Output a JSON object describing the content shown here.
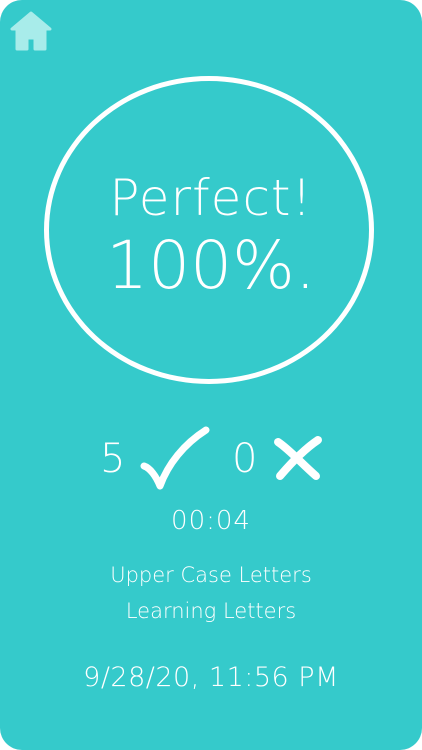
{
  "colors": {
    "background": "#35CACB",
    "foreground": "#FFFFFF",
    "home_icon": "#A8ECEA"
  },
  "header": {
    "home_icon": "home-icon"
  },
  "result": {
    "title": "Perfect!",
    "score": "100%."
  },
  "tally": {
    "correct_count": "5",
    "correct_icon": "check-icon",
    "wrong_count": "0",
    "wrong_icon": "cross-icon"
  },
  "details": {
    "time": "00:04",
    "category": "Upper Case Letters",
    "mode": "Learning Letters",
    "datetime": "9/28/20, 11:56 PM"
  }
}
